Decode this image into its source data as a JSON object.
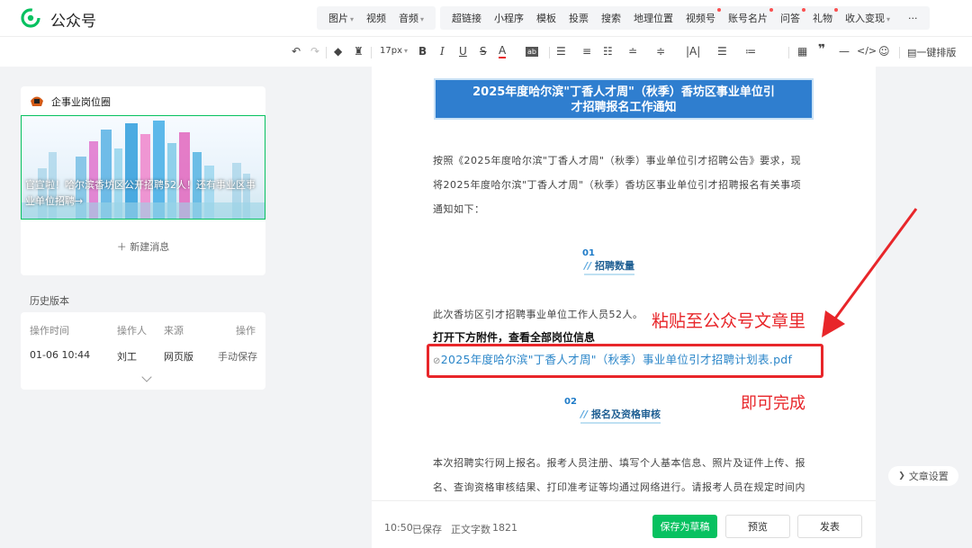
{
  "app": {
    "name": "公众号"
  },
  "insert_menu_1": [
    "图片",
    "视频",
    "音频"
  ],
  "insert_menu_2": [
    {
      "label": "超链接",
      "dot": false,
      "caret": false
    },
    {
      "label": "小程序",
      "dot": false,
      "caret": false
    },
    {
      "label": "模板",
      "dot": false,
      "caret": false
    },
    {
      "label": "投票",
      "dot": false,
      "caret": false
    },
    {
      "label": "搜索",
      "dot": false,
      "caret": false
    },
    {
      "label": "地理位置",
      "dot": false,
      "caret": false
    },
    {
      "label": "视频号",
      "dot": true,
      "caret": false
    },
    {
      "label": "账号名片",
      "dot": true,
      "caret": false
    },
    {
      "label": "问答",
      "dot": true,
      "caret": false
    },
    {
      "label": "礼物",
      "dot": true,
      "caret": false
    },
    {
      "label": "收入变现",
      "dot": false,
      "caret": true
    }
  ],
  "more_label": "···",
  "format_toolbar": {
    "font_size": "17px",
    "one_click_layout": "一键排版"
  },
  "account": {
    "name": "企事业岗位圈"
  },
  "draft": {
    "cover_title": "官宣啦！哈尔滨香坊区公开招聘52人！还有事业区事业单位招聘→",
    "new_message": "新建消息"
  },
  "history": {
    "title": "历史版本",
    "headers": [
      "操作时间",
      "操作人",
      "来源",
      "操作"
    ],
    "row": [
      "01-06 10:44",
      "刘工",
      "网页版",
      "手动保存"
    ]
  },
  "article": {
    "headline_line1": "2025年度哈尔滨\"丁香人才周\"（秋季）香坊区事业单位引",
    "headline_line2": "才招聘报名工作通知",
    "intro_1": "按照《2025年度哈尔滨\"丁香人才周\"（秋季）事业单位引才招聘公告》要求，现",
    "intro_2": "将2025年度哈尔滨\"丁香人才周\"（秋季）香坊区事业单位引才招聘报名有关事项",
    "intro_3": "通知如下：",
    "section1_num": "01",
    "section1_title": "招聘数量",
    "section1_text": "此次香坊区引才招聘事业单位工作人员52人。",
    "bold_line": "打开下方附件，查看全部岗位信息",
    "attachment": "2025年度哈尔滨\"丁香人才周\"（秋季）事业单位引才招聘计划表.pdf",
    "section2_num": "02",
    "section2_title": "报名及资格审核",
    "section2_text_1": "本次招聘实行网上报名。报考人员注册、填写个人基本信息、照片及证件上传、报",
    "section2_text_2": "名、查询资格审核结果、打印准考证等均通过网络进行。请报考人员在规定时间内"
  },
  "annotations": {
    "paste": "粘贴至公众号文章里",
    "done": "即可完成"
  },
  "footer": {
    "time": "10:50",
    "saved": "已保存",
    "word_count_label": "正文字数",
    "word_count": "1821",
    "save_draft": "保存为草稿",
    "preview": "预览",
    "publish": "发表"
  },
  "article_settings": "文章设置",
  "colors": {
    "accent_green": "#07c160",
    "headline_blue": "#2f7ecf",
    "annotation_red": "#e8262a"
  }
}
